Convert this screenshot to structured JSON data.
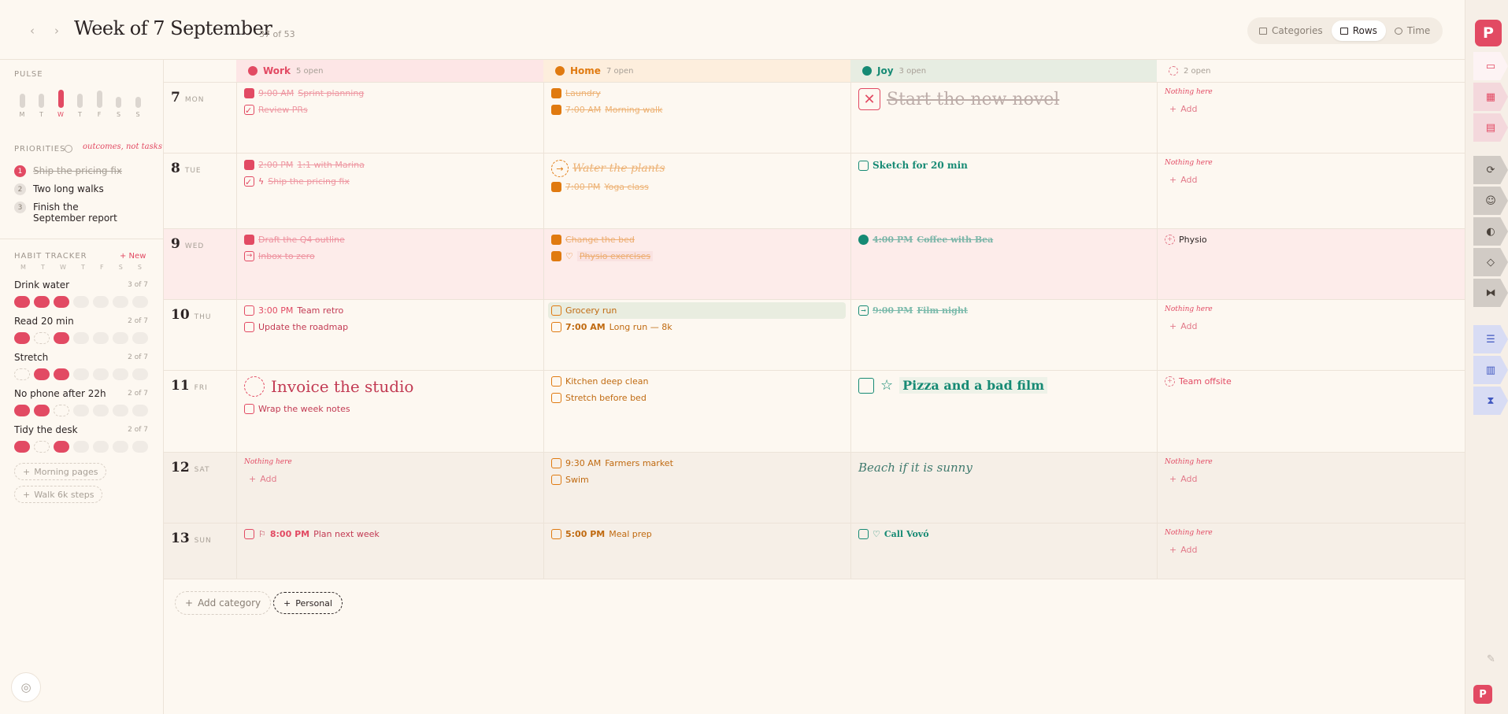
{
  "header": {
    "title": "Week of 7 September",
    "week_count": "37 of 53",
    "prev": "‹",
    "next": "›",
    "views": [
      {
        "label": "Categories",
        "icon": "tags-icon"
      },
      {
        "label": "Rows",
        "icon": "rows-icon",
        "active": true
      },
      {
        "label": "Time",
        "icon": "clock-icon"
      }
    ]
  },
  "sidebar": {
    "pulse": {
      "title": "PULSE",
      "days": [
        "M",
        "T",
        "W",
        "T",
        "F",
        "S",
        "S"
      ],
      "today_index": 2,
      "levels": [
        0.7,
        0.7,
        0.9,
        0.7,
        0.85,
        0.55,
        0.55
      ]
    },
    "priorities": {
      "title": "PRIORITIES",
      "note": "outcomes, not tasks",
      "items": [
        {
          "num": "1",
          "text": "Ship the pricing fix",
          "done": true
        },
        {
          "num": "2",
          "text": "Two long walks",
          "done": false
        },
        {
          "num": "3",
          "text": "Finish the September report",
          "done": false
        }
      ]
    },
    "habits": {
      "title": "HABIT TRACKER",
      "new_label": "+ New",
      "days": [
        "M",
        "T",
        "W",
        "T",
        "F",
        "S",
        "S"
      ],
      "items": [
        {
          "name": "Drink water",
          "count": "3 of 7",
          "states": [
            "on",
            "on",
            "on",
            "off",
            "off",
            "off",
            "off"
          ]
        },
        {
          "name": "Read 20 min",
          "count": "2 of 7",
          "states": [
            "on",
            "skip",
            "on",
            "off",
            "off",
            "off",
            "off"
          ]
        },
        {
          "name": "Stretch",
          "count": "2 of 7",
          "states": [
            "skip",
            "on",
            "on",
            "off",
            "off",
            "off",
            "off"
          ]
        },
        {
          "name": "No phone after 22h",
          "count": "2 of 7",
          "states": [
            "on",
            "on",
            "skip",
            "off",
            "off",
            "off",
            "off"
          ]
        },
        {
          "name": "Tidy the desk",
          "count": "2 of 7",
          "states": [
            "on",
            "skip",
            "on",
            "off",
            "off",
            "off",
            "off"
          ]
        }
      ],
      "suggestions": [
        "Morning pages",
        "Walk 6k steps"
      ]
    }
  },
  "columns": [
    {
      "name": "Work",
      "open": "5 open",
      "color": "#e24a63",
      "bg": "#fde6e6"
    },
    {
      "name": "Home",
      "open": "7 open",
      "color": "#e07a10",
      "bg": "#fdeedd"
    },
    {
      "name": "Joy",
      "open": "3 open",
      "color": "#168a74",
      "bg": "#e7ede2"
    },
    {
      "name": "",
      "open": "2 open",
      "color": "#e27a8a",
      "bg": "#fdf8f1"
    }
  ],
  "days": [
    {
      "num": "7",
      "dow": "MON"
    },
    {
      "num": "8",
      "dow": "TUE"
    },
    {
      "num": "9",
      "dow": "WED"
    },
    {
      "num": "10",
      "dow": "THU"
    },
    {
      "num": "11",
      "dow": "FRI"
    },
    {
      "num": "12",
      "dow": "SAT"
    },
    {
      "num": "13",
      "dow": "SUN"
    }
  ],
  "cells": {
    "mon": {
      "work1": {
        "time": "9:00 AM",
        "text": "Sprint planning"
      },
      "work2": {
        "text": "Review PRs"
      },
      "home1": {
        "text": "Laundry"
      },
      "home2": {
        "time": "7:00 AM",
        "text": "Morning walk"
      },
      "joy1": {
        "text": "Start the new novel"
      }
    },
    "tue": {
      "work1": {
        "time": "2:00 PM",
        "text": "1:1 with Marina"
      },
      "work2": {
        "text": "Ship the pricing fix"
      },
      "home1": {
        "text": "Water the plants"
      },
      "home2": {
        "time": "7:00 PM",
        "text": "Yoga class"
      },
      "joy1": {
        "text": "Sketch for 20 min"
      }
    },
    "wed": {
      "work1": {
        "text": "Draft the Q4 outline"
      },
      "work2": {
        "text": "Inbox to zero"
      },
      "home1": {
        "text": "Change the bed"
      },
      "home2": {
        "text": "Physio exercises"
      },
      "joy1": {
        "time": "4:00 PM",
        "text": "Coffee with Bea"
      },
      "other1": {
        "text": "Physio"
      }
    },
    "thu": {
      "work1": {
        "time": "3:00 PM",
        "text": "Team retro"
      },
      "work2": {
        "text": "Update the roadmap"
      },
      "home1": {
        "text": "Grocery run"
      },
      "home2": {
        "time": "7:00 AM",
        "text": "Long run — 8k"
      },
      "joy1": {
        "time": "9:00 PM",
        "text": "Film night"
      }
    },
    "fri": {
      "work1": {
        "text": "Invoice the studio"
      },
      "work2": {
        "text": "Wrap the week notes"
      },
      "home1": {
        "text": "Kitchen deep clean"
      },
      "home2": {
        "text": "Stretch before bed"
      },
      "joy1": {
        "text": "Pizza and a bad film"
      },
      "other1": {
        "text": "Team offsite"
      }
    },
    "sat": {
      "home1": {
        "time": "9:30 AM",
        "text": "Farmers market"
      },
      "home2": {
        "text": "Swim"
      },
      "joy1": {
        "text": "Beach if it is sunny"
      }
    },
    "sun": {
      "work1": {
        "time": "8:00 PM",
        "text": "Plan next week"
      },
      "home1": {
        "time": "5:00 PM",
        "text": "Meal prep"
      },
      "joy1": {
        "text": "Call Vovó"
      }
    }
  },
  "empty": {
    "nothing": "Nothing here",
    "add": "Add",
    "plus": "+"
  },
  "footer": {
    "add_category": "Add category",
    "personal": "Personal",
    "plus": "+"
  },
  "rail": {
    "logo": "P"
  }
}
